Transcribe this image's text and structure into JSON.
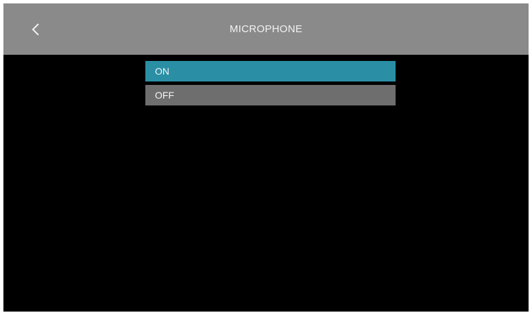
{
  "header": {
    "title": "MICROPHONE",
    "back_icon": "chevron-left-icon",
    "background": "#8a8a8a"
  },
  "options": [
    {
      "label": "ON",
      "selected": true
    },
    {
      "label": "OFF",
      "selected": false
    }
  ],
  "colors": {
    "screen_background": "#000000",
    "selected_option": "#2a8fa5",
    "unselected_option": "#6e6e6e",
    "text": "#f4f4f4"
  }
}
